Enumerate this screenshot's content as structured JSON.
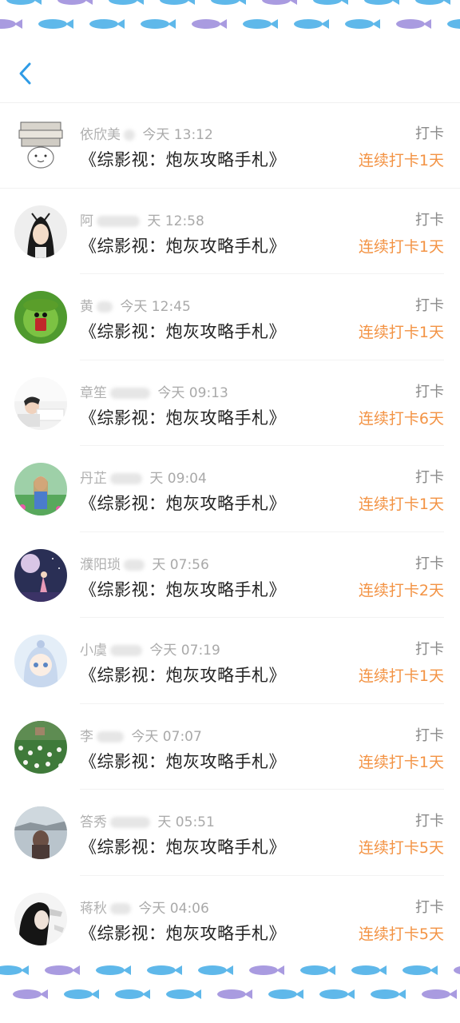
{
  "header": {
    "back_icon": "chevron-left-icon",
    "accent": "#2e9be6"
  },
  "colors": {
    "streak": "#f39344",
    "meta": "#a9a9a9",
    "title": "#222222",
    "fish_blue": "#5fb8ea",
    "fish_purple": "#a99be0"
  },
  "items": [
    {
      "name": "依欣美",
      "time": "今天 13:12",
      "book": "《综影视：炮灰攻略手札》",
      "tag": "打卡",
      "streak": "连续打卡1天"
    },
    {
      "name": "阿",
      "time": "天 12:58",
      "book": "《综影视：炮灰攻略手札》",
      "tag": "打卡",
      "streak": "连续打卡1天"
    },
    {
      "name": "黄",
      "time": "今天 12:45",
      "book": "《综影视：炮灰攻略手札》",
      "tag": "打卡",
      "streak": "连续打卡1天"
    },
    {
      "name": "章笙",
      "time": "今天 09:13",
      "book": "《综影视：炮灰攻略手札》",
      "tag": "打卡",
      "streak": "连续打卡6天"
    },
    {
      "name": "丹芷",
      "time": "天 09:04",
      "book": "《综影视：炮灰攻略手札》",
      "tag": "打卡",
      "streak": "连续打卡1天"
    },
    {
      "name": "濮阳琐",
      "time": "天 07:56",
      "book": "《综影视：炮灰攻略手札》",
      "tag": "打卡",
      "streak": "连续打卡2天"
    },
    {
      "name": "小虞",
      "time": "今天 07:19",
      "book": "《综影视：炮灰攻略手札》",
      "tag": "打卡",
      "streak": "连续打卡1天"
    },
    {
      "name": "李",
      "time": "今天 07:07",
      "book": "《综影视：炮灰攻略手札》",
      "tag": "打卡",
      "streak": "连续打卡1天"
    },
    {
      "name": "答秀",
      "time": "天 05:51",
      "book": "《综影视：炮灰攻略手札》",
      "tag": "打卡",
      "streak": "连续打卡5天"
    },
    {
      "name": "蒋秋",
      "time": "今天 04:06",
      "book": "《综影视：炮灰攻略手札》",
      "tag": "打卡",
      "streak": "连续打卡5天"
    }
  ]
}
